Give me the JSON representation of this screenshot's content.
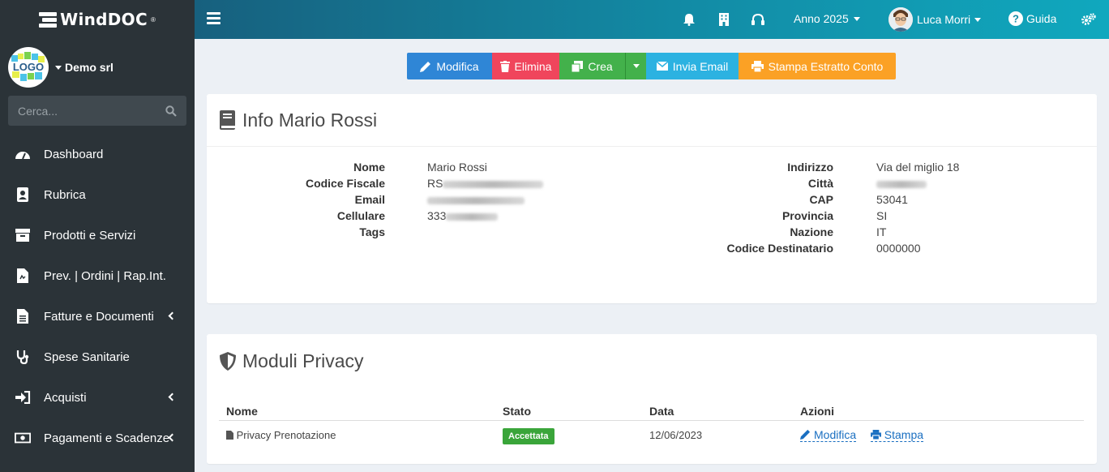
{
  "brand": {
    "name": "WindDOC",
    "reg": "®"
  },
  "company": {
    "logo_text": "LOGO",
    "name": "Demo srl"
  },
  "search": {
    "placeholder": "Cerca..."
  },
  "sidebar": {
    "items": [
      {
        "label": "Dashboard",
        "icon": "dashboard-icon"
      },
      {
        "label": "Rubrica",
        "icon": "address-book-icon"
      },
      {
        "label": "Prodotti e Servizi",
        "icon": "box-icon"
      },
      {
        "label": "Prev. | Ordini | Rap.Int.",
        "icon": "document-icon"
      },
      {
        "label": "Fatture e Documenti",
        "icon": "file-icon",
        "submenu": true
      },
      {
        "label": "Spese Sanitarie",
        "icon": "stethoscope-icon"
      },
      {
        "label": "Acquisti",
        "icon": "sign-in-icon",
        "submenu": true
      },
      {
        "label": "Pagamenti e Scadenze",
        "icon": "money-icon",
        "submenu": true
      }
    ]
  },
  "topbar": {
    "anno": "Anno 2025",
    "user": "Luca Morri",
    "guida": "Guida"
  },
  "actions": {
    "modifica": "Modifica",
    "elimina": "Elimina",
    "crea": "Crea",
    "invia_email": "Invia Email",
    "stampa": "Stampa Estratto Conto"
  },
  "info": {
    "title": "Info Mario Rossi",
    "left": [
      {
        "label": "Nome",
        "value": "Mario Rossi"
      },
      {
        "label": "Codice Fiscale",
        "value": "RS"
      },
      {
        "label": "Email",
        "value": ""
      },
      {
        "label": "Cellulare",
        "value": "333"
      },
      {
        "label": "Tags",
        "value": ""
      }
    ],
    "right": [
      {
        "label": "Indirizzo",
        "value": "Via del miglio 18"
      },
      {
        "label": "Città",
        "value": ""
      },
      {
        "label": "CAP",
        "value": "53041"
      },
      {
        "label": "Provincia",
        "value": "SI"
      },
      {
        "label": "Nazione",
        "value": "IT"
      },
      {
        "label": "Codice Destinatario",
        "value": "0000000"
      }
    ]
  },
  "privacy": {
    "title": "Moduli Privacy",
    "headers": {
      "nome": "Nome",
      "stato": "Stato",
      "data": "Data",
      "azioni": "Azioni"
    },
    "rows": [
      {
        "nome": "Privacy Prenotazione",
        "stato": "Accettata",
        "data": "12/06/2023",
        "modifica": "Modifica",
        "stampa": "Stampa"
      }
    ]
  },
  "colors": {
    "sidebar_bg": "#2b3338",
    "topbar_start": "#17607e",
    "topbar_end": "#10a8be",
    "btn_blue": "#2f86d6",
    "btn_red": "#f0455c",
    "btn_green": "#43b14b",
    "btn_cyan": "#2cb2e1",
    "btn_orange": "#fba125",
    "badge_green": "#3aa53a"
  }
}
